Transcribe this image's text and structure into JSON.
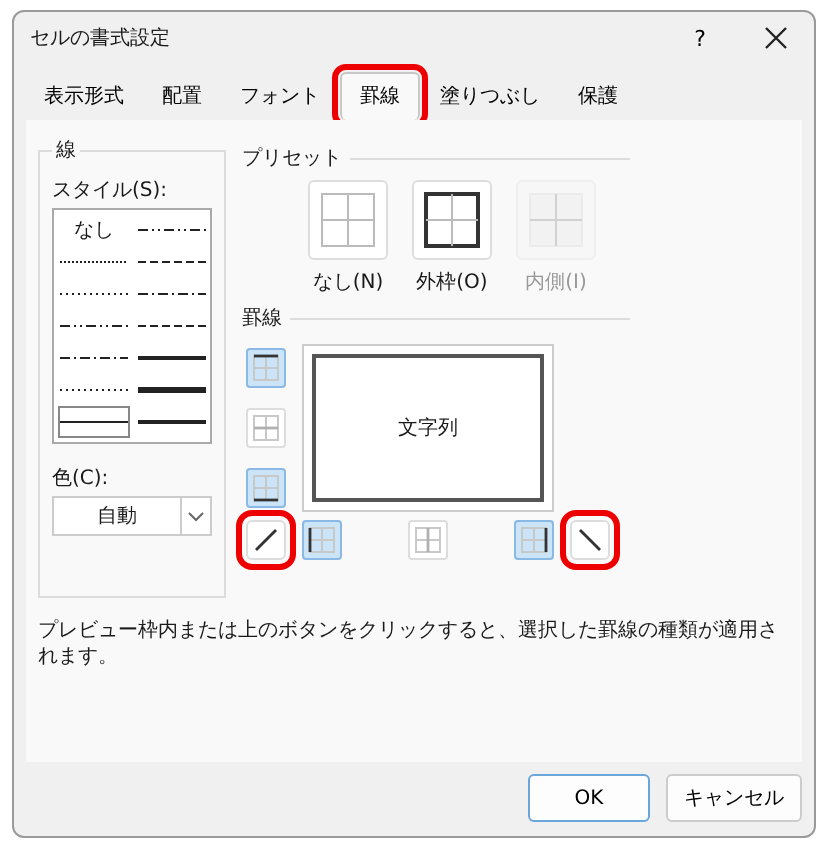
{
  "window": {
    "title": "セルの書式設定",
    "help": "?"
  },
  "tabs": [
    {
      "label": "表示形式",
      "selected": false,
      "highlighted": false
    },
    {
      "label": "配置",
      "selected": false,
      "highlighted": false
    },
    {
      "label": "フォント",
      "selected": false,
      "highlighted": false
    },
    {
      "label": "罫線",
      "selected": true,
      "highlighted": true
    },
    {
      "label": "塗りつぶし",
      "selected": false,
      "highlighted": false
    },
    {
      "label": "保護",
      "selected": false,
      "highlighted": false
    }
  ],
  "line": {
    "title": "線",
    "style_label": "スタイル(S):",
    "styles": [
      {
        "kind": "none",
        "label": "なし",
        "selected": false
      },
      {
        "kind": "dashdotdot",
        "selected": false
      },
      {
        "kind": "hair",
        "selected": false
      },
      {
        "kind": "dashed",
        "selected": false
      },
      {
        "kind": "dotted",
        "selected": false
      },
      {
        "kind": "dashdot",
        "selected": false
      },
      {
        "kind": "dashdotdot",
        "selected": false
      },
      {
        "kind": "dashed",
        "selected": false
      },
      {
        "kind": "dashdot",
        "selected": false
      },
      {
        "kind": "medium",
        "selected": false
      },
      {
        "kind": "dotted",
        "selected": false
      },
      {
        "kind": "thick",
        "selected": false
      },
      {
        "kind": "thin",
        "selected": true
      },
      {
        "kind": "medium",
        "selected": false
      }
    ],
    "color_label": "色(C):",
    "color_value": "自動"
  },
  "presets": {
    "title": "プリセット",
    "items": [
      {
        "kind": "none",
        "label": "なし(N)",
        "disabled": false
      },
      {
        "kind": "outline",
        "label": "外枠(O)",
        "disabled": false
      },
      {
        "kind": "inside",
        "label": "内側(I)",
        "disabled": true
      }
    ]
  },
  "border": {
    "title": "罫線",
    "preview_text": "文字列",
    "buttons": [
      {
        "kind": "top",
        "on": true,
        "disabled": false,
        "highlighted": false
      },
      {
        "kind": "hmid",
        "on": false,
        "disabled": true,
        "highlighted": false
      },
      {
        "kind": "bottom",
        "on": true,
        "disabled": false,
        "highlighted": false
      },
      {
        "kind": "diagup",
        "on": false,
        "disabled": false,
        "highlighted": true
      },
      {
        "kind": "left",
        "on": true,
        "disabled": false,
        "highlighted": false
      },
      {
        "kind": "vmid",
        "on": false,
        "disabled": true,
        "highlighted": false
      },
      {
        "kind": "right",
        "on": true,
        "disabled": false,
        "highlighted": false
      },
      {
        "kind": "diagdown",
        "on": false,
        "disabled": false,
        "highlighted": true
      }
    ]
  },
  "hint": "プレビュー枠内または上のボタンをクリックすると、選択した罫線の種類が適用されます。",
  "buttons": [
    {
      "label": "OK",
      "default": true
    },
    {
      "label": "キャンセル",
      "default": false
    }
  ]
}
